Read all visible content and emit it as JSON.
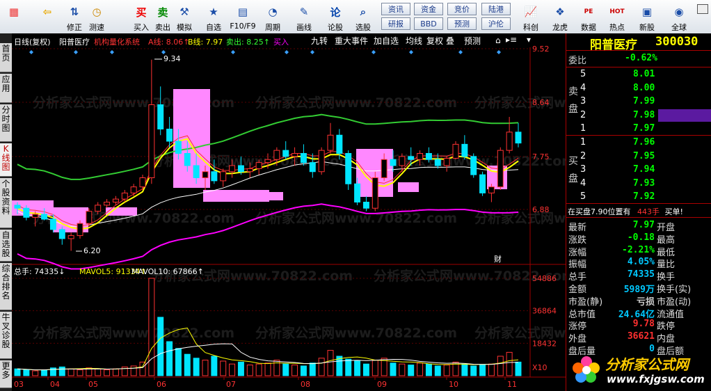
{
  "toolbar": {
    "buttons": [
      {
        "label": "",
        "icon": "grid-icon"
      },
      {
        "label": "",
        "icon": "back-arrow-icon"
      },
      {
        "label": "修正",
        "icon": "up-down-arrows-icon"
      },
      {
        "label": "测速",
        "icon": "clock-icon"
      },
      {
        "label": "买入",
        "icon": "buy-icon",
        "glyph": "买"
      },
      {
        "label": "卖出",
        "icon": "sell-icon",
        "glyph": "卖"
      },
      {
        "label": "模拟",
        "icon": "hammer-icon"
      },
      {
        "label": "自选",
        "icon": "star-icon"
      },
      {
        "label": "F10/F9",
        "icon": "f10-icon"
      },
      {
        "label": "周期",
        "icon": "cycle-icon"
      },
      {
        "label": "画线",
        "icon": "pencil-icon"
      },
      {
        "label": "论股",
        "icon": "discuss-icon",
        "glyph": "论"
      },
      {
        "label": "选股",
        "icon": "screener-icon"
      },
      {
        "label": "科创",
        "icon": "kechuang-icon"
      },
      {
        "label": "龙虎",
        "icon": "dragon-tiger-icon"
      },
      {
        "label": "数据",
        "icon": "pe-icon",
        "glyph": "PE"
      },
      {
        "label": "热点",
        "icon": "hot-icon",
        "glyph": "HOT"
      },
      {
        "label": "新股",
        "icon": "new-stock-icon"
      },
      {
        "label": "全球",
        "icon": "globe-icon"
      }
    ],
    "squares": [
      [
        "资讯",
        "资金",
        "竞价",
        "陆港"
      ],
      [
        "研报",
        "BBD",
        "预测",
        "沪伦"
      ]
    ]
  },
  "sidebar": {
    "tabs": [
      "首页",
      "应用",
      "分时图",
      "K线图",
      "个股资料",
      "自选股",
      "综合排名",
      "牛叉诊股",
      "更多"
    ]
  },
  "chart": {
    "info": {
      "period": "日线(复权)",
      "stock": "阳普医疗",
      "indicator": "机构量化系统",
      "a_line": "A线: 8.06↑",
      "b_line": "B线: 7.97",
      "sell_label": "卖出: 8.25↑",
      "buy_label": "买入"
    },
    "func_tabs": [
      "九转",
      "重大事件",
      "加自选",
      "均线",
      "复权",
      "叠",
      "预测"
    ],
    "price_axis": [
      "9.52",
      "8.64",
      "7.75",
      "6.88"
    ],
    "vol_axis": [
      "54886",
      "36864",
      "18432",
      "X10"
    ],
    "annot_high": "9.34",
    "annot_low": "6.20",
    "cai": "财",
    "vol_info": {
      "total": "总手: 74335↓",
      "ma5": "MAVOL5: 91334↑",
      "ma10": "MAVOL10: 67866↑"
    },
    "months": [
      "03",
      "04",
      "05",
      "06",
      "07",
      "08",
      "09",
      "10",
      "11"
    ],
    "watermark": "分析家公式网www.70822.com"
  },
  "chart_data": {
    "type": "candlestick",
    "ylim": [
      6.0,
      9.52
    ],
    "candles": [
      [
        6.95,
        7.0,
        6.8,
        6.9
      ],
      [
        6.9,
        6.95,
        6.7,
        6.75
      ],
      [
        6.75,
        6.85,
        6.6,
        6.8
      ],
      [
        6.8,
        6.9,
        6.7,
        6.72
      ],
      [
        6.72,
        6.8,
        6.5,
        6.55
      ],
      [
        6.55,
        6.6,
        6.3,
        6.4
      ],
      [
        6.4,
        6.5,
        6.2,
        6.45
      ],
      [
        6.45,
        6.7,
        6.4,
        6.65
      ],
      [
        6.65,
        6.9,
        6.6,
        6.85
      ],
      [
        6.85,
        7.0,
        6.8,
        6.95
      ],
      [
        6.95,
        7.05,
        6.9,
        7.0
      ],
      [
        7.0,
        7.1,
        6.95,
        7.05
      ],
      [
        7.05,
        7.2,
        7.0,
        7.15
      ],
      [
        7.15,
        7.3,
        7.1,
        7.25
      ],
      [
        7.25,
        7.45,
        7.2,
        7.4
      ],
      [
        7.4,
        9.34,
        7.3,
        8.6
      ],
      [
        8.6,
        8.9,
        8.1,
        8.2
      ],
      [
        8.2,
        8.4,
        7.9,
        8.0
      ],
      [
        8.0,
        8.2,
        7.7,
        7.8
      ],
      [
        7.8,
        8.0,
        7.5,
        7.6
      ],
      [
        7.6,
        7.8,
        7.3,
        7.4
      ],
      [
        7.4,
        7.6,
        7.2,
        7.5
      ],
      [
        7.5,
        7.7,
        7.3,
        7.35
      ],
      [
        7.35,
        7.55,
        7.25,
        7.5
      ],
      [
        7.5,
        7.7,
        7.4,
        7.6
      ],
      [
        7.6,
        7.75,
        7.45,
        7.5
      ],
      [
        7.5,
        7.65,
        7.4,
        7.55
      ],
      [
        7.55,
        7.7,
        7.45,
        7.65
      ],
      [
        7.65,
        7.8,
        7.55,
        7.7
      ],
      [
        7.7,
        7.9,
        7.6,
        7.85
      ],
      [
        7.85,
        8.0,
        7.7,
        7.75
      ],
      [
        7.75,
        7.9,
        7.6,
        7.8
      ],
      [
        7.8,
        7.95,
        7.6,
        7.65
      ],
      [
        7.65,
        7.8,
        7.4,
        7.5
      ],
      [
        7.5,
        7.9,
        7.45,
        7.85
      ],
      [
        7.85,
        8.3,
        7.8,
        8.1
      ],
      [
        8.1,
        8.2,
        7.7,
        7.8
      ],
      [
        7.8,
        7.85,
        7.2,
        7.3
      ],
      [
        7.3,
        7.4,
        6.95,
        7.0
      ],
      [
        7.0,
        7.1,
        6.85,
        6.9
      ],
      [
        6.9,
        7.5,
        6.85,
        7.4
      ],
      [
        7.4,
        7.8,
        7.35,
        7.7
      ],
      [
        7.7,
        7.85,
        7.5,
        7.6
      ],
      [
        7.6,
        7.8,
        7.5,
        7.75
      ],
      [
        7.75,
        7.9,
        7.6,
        7.7
      ],
      [
        7.7,
        7.85,
        7.6,
        7.8
      ],
      [
        7.8,
        7.9,
        7.65,
        7.7
      ],
      [
        7.7,
        7.8,
        7.55,
        7.6
      ],
      [
        7.6,
        7.75,
        7.5,
        7.72
      ],
      [
        7.72,
        8.0,
        7.7,
        7.95
      ],
      [
        7.95,
        8.1,
        7.7,
        7.75
      ],
      [
        7.75,
        7.8,
        7.4,
        7.45
      ],
      [
        7.45,
        7.5,
        7.1,
        7.15
      ],
      [
        7.15,
        7.3,
        7.0,
        7.25
      ],
      [
        7.25,
        7.9,
        7.2,
        7.85
      ],
      [
        7.85,
        8.4,
        7.8,
        8.15
      ],
      [
        8.15,
        8.3,
        7.9,
        7.97
      ]
    ],
    "volumes": [
      0.07,
      0.06,
      0.05,
      0.06,
      0.08,
      0.09,
      0.07,
      0.06,
      0.08,
      0.07,
      0.06,
      0.07,
      0.09,
      0.1,
      0.14,
      1.0,
      0.6,
      0.35,
      0.28,
      0.22,
      0.18,
      0.16,
      0.2,
      0.15,
      0.12,
      0.14,
      0.11,
      0.12,
      0.13,
      0.16,
      0.12,
      0.11,
      0.1,
      0.13,
      0.18,
      0.26,
      0.2,
      0.17,
      0.15,
      0.12,
      0.16,
      0.18,
      0.13,
      0.12,
      0.11,
      0.13,
      0.12,
      0.1,
      0.11,
      0.14,
      0.12,
      0.1,
      0.11,
      0.12,
      0.2,
      0.24,
      0.14
    ]
  },
  "quote": {
    "stock_name": "阳普医疗",
    "stock_code": "300030",
    "weibi_label": "委比",
    "weibi_value": "-0.62%",
    "sell_side": "卖盘",
    "buy_side": "买盘",
    "asks": [
      [
        "5",
        "8.01"
      ],
      [
        "4",
        "8.00"
      ],
      [
        "3",
        "7.99"
      ],
      [
        "2",
        "7.98"
      ],
      [
        "1",
        "7.97"
      ]
    ],
    "bids": [
      [
        "1",
        "7.96"
      ],
      [
        "2",
        "7.95"
      ],
      [
        "3",
        "7.94"
      ],
      [
        "4",
        "7.93"
      ],
      [
        "5",
        "7.92"
      ]
    ],
    "notice_text": "在买盘7.90位置有",
    "notice_qty": "443手",
    "notice_end": "买单!",
    "stats": [
      {
        "l": "最新",
        "v": "7.97",
        "r": "开盘",
        "c": "#00ff00"
      },
      {
        "l": "涨跌",
        "v": "-0.18",
        "r": "最高",
        "c": "#00ff00"
      },
      {
        "l": "涨幅",
        "v": "-2.21%",
        "r": "最低",
        "c": "#00ff00"
      },
      {
        "l": "振幅",
        "v": "4.05%",
        "r": "量比",
        "c": "#00c8ff"
      },
      {
        "l": "总手",
        "v": "74335",
        "r": "换手",
        "c": "#00c8ff"
      },
      {
        "l": "金额",
        "v": "5989万",
        "r": "换手(实)",
        "c": "#00c8ff"
      },
      {
        "l": "市盈(静)",
        "v": "亏损",
        "r": "市盈(动)",
        "c": "#cccccc"
      },
      {
        "l": "总市值",
        "v": "24.64亿",
        "r": "流通值",
        "c": "#00c8ff"
      },
      {
        "l": "涨停",
        "v": "9.78",
        "r": "跌停",
        "c": "#ff3030"
      },
      {
        "l": "外盘",
        "v": "36621",
        "r": "内盘",
        "c": "#ff3030"
      },
      {
        "l": "盘后量",
        "v": "0",
        "r": "盘后额",
        "c": "#00c8ff"
      }
    ],
    "logo_text": "分析家公式网",
    "logo_url": "www.fxjgsw.com"
  },
  "colors": {
    "up": "#ff3232",
    "down": "#00e5ff",
    "green_line": "#33cc33",
    "yellow_line": "#ffff00",
    "pink": "#ff88ff",
    "magenta": "#ff00ff"
  }
}
